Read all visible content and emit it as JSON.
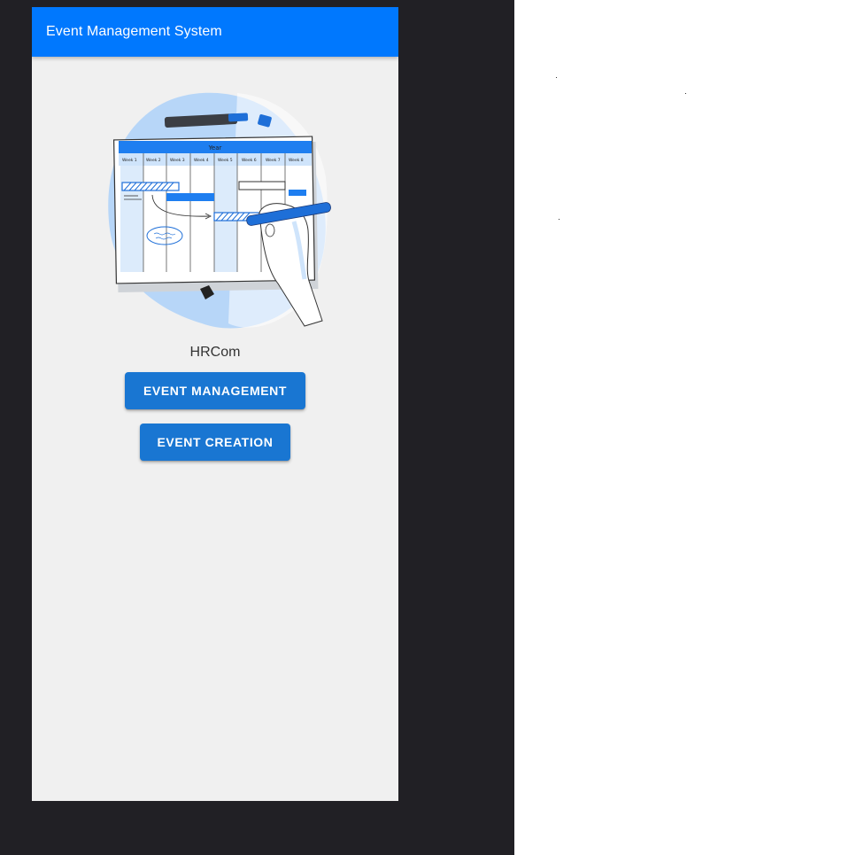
{
  "app_bar": {
    "title": "Event Management System"
  },
  "illustration": {
    "header_label": "Year",
    "week_labels": [
      "Week 1",
      "Week 2",
      "Week 3",
      "Week 4",
      "Week 5",
      "Week 6",
      "Week 7",
      "Week 8"
    ],
    "icon": "planning-board-illustration"
  },
  "company": {
    "name": "HRCom"
  },
  "actions": {
    "event_management_label": "EVENT MANAGEMENT",
    "event_creation_label": "EVENT CREATION"
  },
  "colors": {
    "app_bar": "#0078fe",
    "button": "#1976d2",
    "screen_bg": "#f0f0f0",
    "backdrop": "#212025"
  }
}
